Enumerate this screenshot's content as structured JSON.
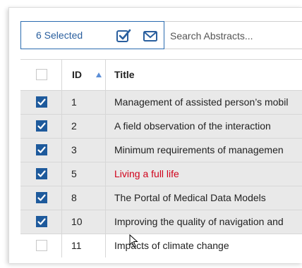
{
  "toolbar": {
    "selected_label": "6 Selected",
    "check_icon": "checkbox-check-icon",
    "mail_icon": "envelope-icon"
  },
  "search": {
    "placeholder": "Search Abstracts..."
  },
  "table": {
    "columns": {
      "id": "ID",
      "title": "Title"
    },
    "rows": [
      {
        "id": "1",
        "title": "Management of assisted person’s mobil",
        "checked": true
      },
      {
        "id": "2",
        "title": "A field observation of the interaction",
        "checked": true
      },
      {
        "id": "3",
        "title": "Minimum requirements of managemen",
        "checked": true
      },
      {
        "id": "5",
        "title": "Living a full life",
        "checked": true,
        "highlight": true
      },
      {
        "id": "8",
        "title": "The Portal of Medical Data Models",
        "checked": true
      },
      {
        "id": "10",
        "title": "Improving the quality of navigation and",
        "checked": true
      },
      {
        "id": "11",
        "title": "Impacts of climate change",
        "checked": false
      }
    ]
  },
  "colors": {
    "accent": "#2a5f9e",
    "checkbox": "#1e5a9c",
    "highlight_text": "#d0021b",
    "selected_row": "#e9e9e9"
  }
}
